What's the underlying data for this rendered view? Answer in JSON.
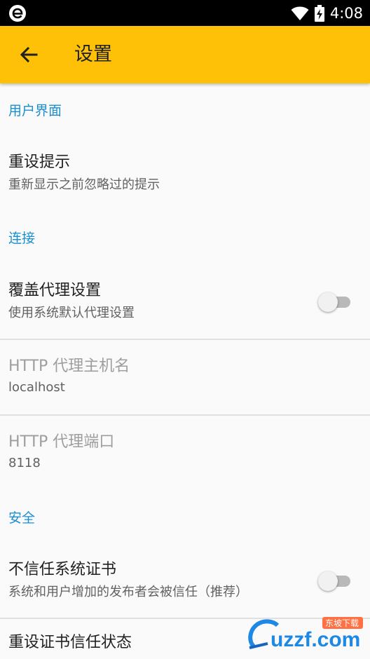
{
  "status_bar": {
    "time": "4:08",
    "icons": [
      "browser-e-icon",
      "wifi-icon",
      "battery-charging-icon"
    ]
  },
  "app_bar": {
    "title": "设置",
    "back_icon": "arrow-back-icon",
    "color": "#ffc107"
  },
  "sections": {
    "ui": {
      "header": "用户界面"
    },
    "connection": {
      "header": "连接"
    },
    "security": {
      "header": "安全"
    }
  },
  "prefs": {
    "reset_tips": {
      "title": "重设提示",
      "summary": "重新显示之前忽略过的提示"
    },
    "override_proxy": {
      "title": "覆盖代理设置",
      "summary": "使用系统默认代理设置",
      "enabled": false
    },
    "proxy_host": {
      "title": "HTTP 代理主机名",
      "value": "localhost"
    },
    "proxy_port": {
      "title": "HTTP 代理端口",
      "value": "8118"
    },
    "distrust_system_certs": {
      "title": "不信任系统证书",
      "summary": "系统和用户增加的发布者会被信任（推荐）",
      "enabled": false
    },
    "reset_cert_trust": {
      "title": "重设证书信任状态"
    }
  },
  "colors": {
    "accent": "#1a8fcf",
    "appbar": "#ffc107",
    "disabled_text": "#9e9e9e"
  },
  "watermark": {
    "text": "uzzf.com",
    "tag": "东坡下载"
  }
}
